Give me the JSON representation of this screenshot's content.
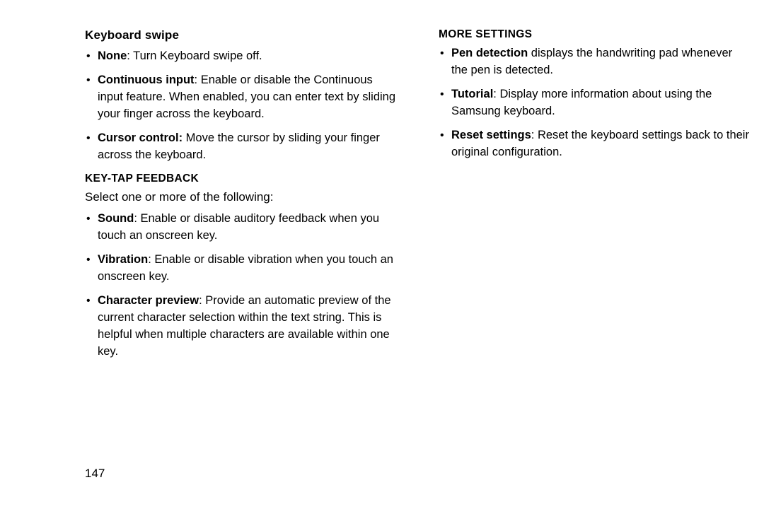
{
  "page_number": "147",
  "left": {
    "section1": {
      "heading": "Keyboard swipe",
      "items": [
        {
          "bold": "None",
          "rest": ": Turn Keyboard swipe off."
        },
        {
          "bold": "Continuous input",
          "rest": ": Enable or disable the Continuous input feature. When enabled, you can enter text by sliding your finger across the keyboard."
        },
        {
          "bold": "Cursor control:",
          "rest": " Move the cursor by sliding your finger across the keyboard."
        }
      ]
    },
    "section2": {
      "heading": "KEY-TAP FEEDBACK",
      "intro": "Select one or more of the following:",
      "items": [
        {
          "bold": "Sound",
          "rest": ": Enable or disable auditory feedback when you touch an onscreen key."
        },
        {
          "bold": "Vibration",
          "rest": ": Enable or disable vibration when you touch an onscreen key."
        },
        {
          "bold": "Character preview",
          "rest": ": Provide an automatic preview of the current character selection within the text string. This is helpful when multiple characters are available within one key."
        }
      ]
    }
  },
  "right": {
    "section1": {
      "heading": "MORE SETTINGS",
      "items": [
        {
          "bold": "Pen detection",
          "rest": " displays the handwriting pad whenever the pen is detected."
        },
        {
          "bold": "Tutorial",
          "rest": ": Display more information about using the Samsung keyboard."
        },
        {
          "bold": "Reset settings",
          "rest": ": Reset the keyboard settings back to their original configuration."
        }
      ]
    }
  }
}
